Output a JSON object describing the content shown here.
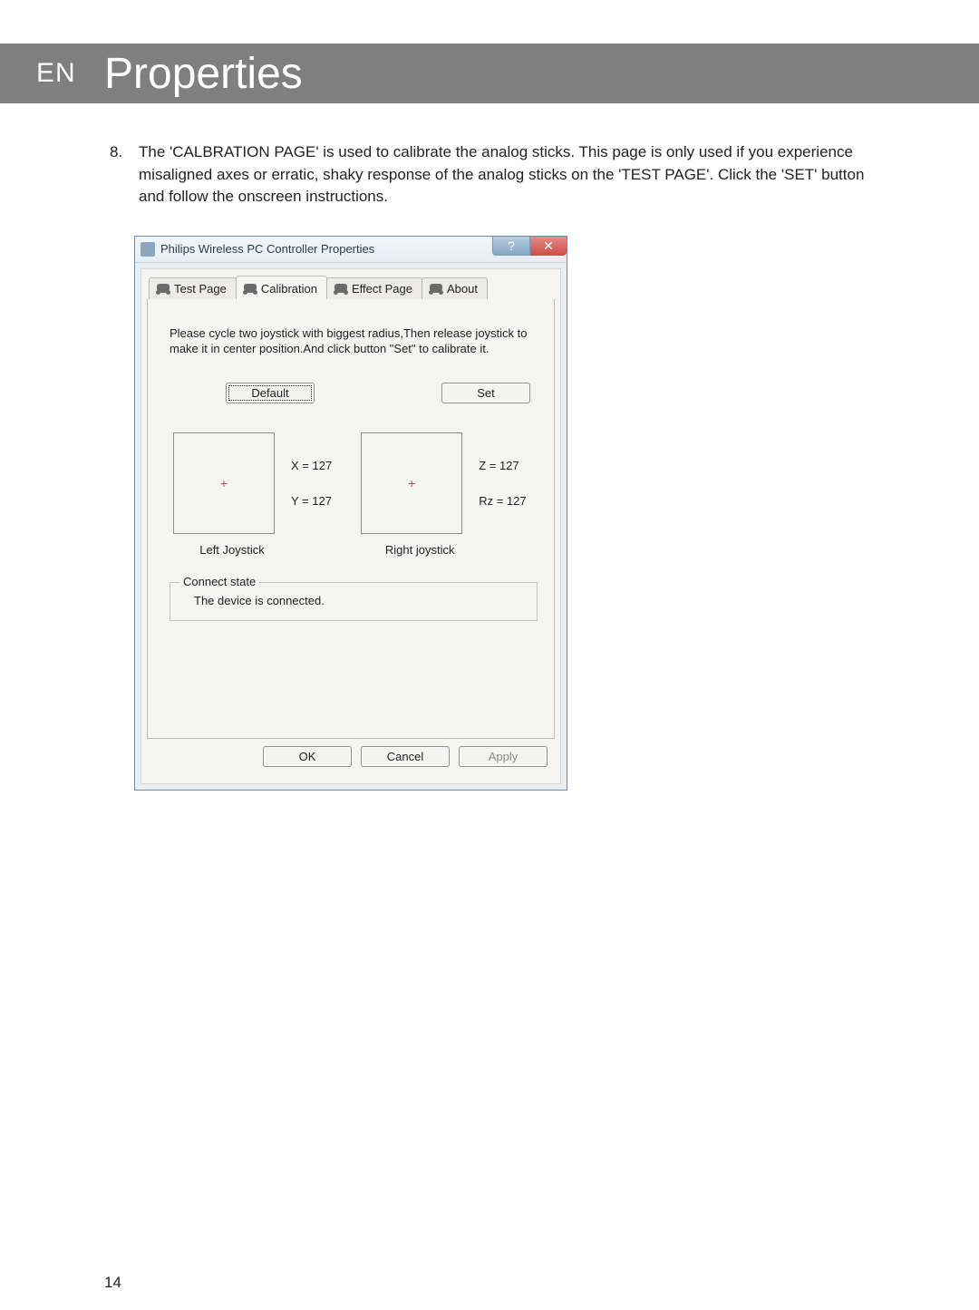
{
  "header": {
    "lang": "EN",
    "title": "Properties"
  },
  "body": {
    "item_number": "8.",
    "text": "The 'CALBRATION PAGE' is used to calibrate the analog sticks. This page is only used if you experience misaligned axes or erratic, shaky response of the analog sticks on the 'TEST PAGE'.  Click the 'SET' button and follow the onscreen instructions."
  },
  "dialog": {
    "title": "Philips Wireless PC Controller Properties",
    "help_glyph": "?",
    "close_glyph": "✕",
    "tabs": {
      "test_page": "Test Page",
      "calibration": "Calibration",
      "effect_page": "Effect Page",
      "about": "About"
    },
    "instructions": "Please cycle two joystick with biggest radius,Then release joystick to make it in center position.And click button \"Set\" to calibrate it.",
    "buttons": {
      "default": "Default",
      "set": "Set"
    },
    "left_joystick": {
      "label": "Left Joystick",
      "x": "X = 127",
      "y": "Y = 127"
    },
    "right_joystick": {
      "label": "Right joystick",
      "z": "Z = 127",
      "rz": "Rz = 127"
    },
    "connect_state": {
      "legend": "Connect state",
      "text": "The device is connected."
    },
    "footer": {
      "ok": "OK",
      "cancel": "Cancel",
      "apply": "Apply"
    }
  },
  "page_number": "14"
}
